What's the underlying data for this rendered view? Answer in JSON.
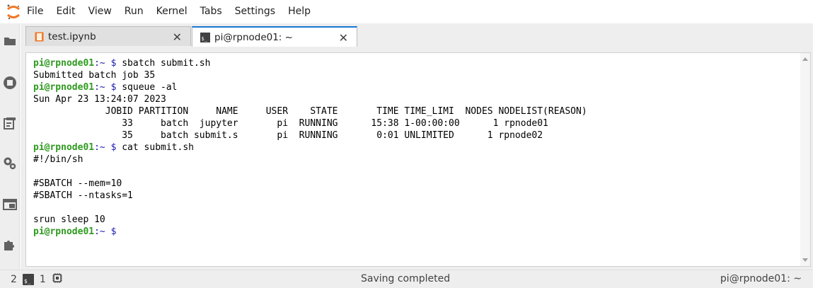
{
  "menubar": {
    "items": [
      "File",
      "Edit",
      "View",
      "Run",
      "Kernel",
      "Tabs",
      "Settings",
      "Help"
    ]
  },
  "sidebar": {
    "icons": [
      "folder-icon",
      "running-icon",
      "command-palette-icon",
      "property-inspector-icon",
      "tabs-icon",
      "extension-icon"
    ]
  },
  "tabs": [
    {
      "label": "test.ipynb",
      "icon": "notebook-icon",
      "active": false
    },
    {
      "label": "pi@rpnode01: ~",
      "icon": "terminal-icon",
      "active": true
    }
  ],
  "terminal": {
    "prompt_user": "pi@rpnode01",
    "prompt_rest": ":~ $",
    "lines": [
      {
        "type": "prompt",
        "cmd": " sbatch submit.sh"
      },
      {
        "type": "out",
        "text": "Submitted batch job 35"
      },
      {
        "type": "prompt",
        "cmd": " squeue -al"
      },
      {
        "type": "out",
        "text": "Sun Apr 23 13:24:07 2023"
      },
      {
        "type": "out",
        "text": "             JOBID PARTITION     NAME     USER    STATE       TIME TIME_LIMI  NODES NODELIST(REASON)"
      },
      {
        "type": "out",
        "text": "                33     batch  jupyter       pi  RUNNING      15:38 1-00:00:00      1 rpnode01"
      },
      {
        "type": "out",
        "text": "                35     batch submit.s       pi  RUNNING       0:01 UNLIMITED      1 rpnode02"
      },
      {
        "type": "prompt",
        "cmd": " cat submit.sh"
      },
      {
        "type": "out",
        "text": "#!/bin/sh"
      },
      {
        "type": "out",
        "text": ""
      },
      {
        "type": "out",
        "text": "#SBATCH --mem=10"
      },
      {
        "type": "out",
        "text": "#SBATCH --ntasks=1"
      },
      {
        "type": "out",
        "text": ""
      },
      {
        "type": "out",
        "text": "srun sleep 10"
      },
      {
        "type": "prompt",
        "cmd": " "
      }
    ]
  },
  "statusbar": {
    "kernel_count": "2",
    "terminal_count": "1",
    "status_text": "Saving completed",
    "right_text": "pi@rpnode01: ~"
  },
  "colors": {
    "accent": "#1976d2",
    "prompt_user": "#2e9a1e",
    "prompt_path": "#1a1ab2",
    "logo_orange": "#f37726"
  }
}
